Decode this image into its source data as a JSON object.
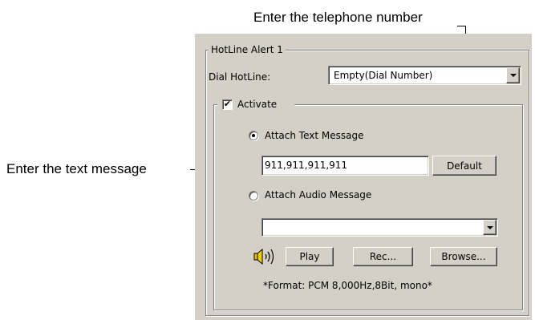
{
  "annotations": {
    "phone": "Enter the telephone number",
    "text": "Enter the text message"
  },
  "hotline": {
    "group_title": "HotLine Alert 1",
    "dial_label": "Dial HotLine:",
    "dial_value": "Empty(Dial Number)",
    "activate_label": "Activate",
    "activate_checked": true,
    "attach_text_label": "Attach Text Message",
    "attach_text_selected": true,
    "text_message_value": "911,911,911,911",
    "default_button": "Default",
    "attach_audio_label": "Attach Audio Message",
    "attach_audio_selected": false,
    "audio_select_value": "",
    "play_button": "Play",
    "rec_button": "Rec...",
    "browse_button": "Browse...",
    "format_note": "*Format: PCM 8,000Hz,8Bit, mono*"
  },
  "icons": {
    "speaker": "speaker-icon",
    "checkmark": "checkmark-icon",
    "dropdown": "chevron-down-icon"
  }
}
